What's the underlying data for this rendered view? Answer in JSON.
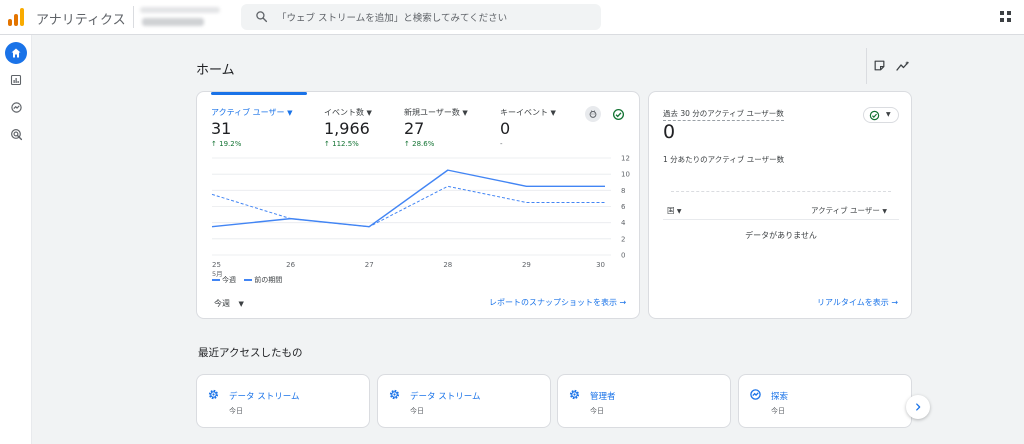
{
  "header": {
    "app_title": "アナリティクス",
    "search_placeholder": "「ウェブ ストリームを追加」と検索してみてください"
  },
  "colors": {
    "primary": "#1a73e8",
    "positive": "#137333",
    "series_line": "#4285f4",
    "logo_bars": [
      "#f9ab00",
      "#e37400",
      "#e37400"
    ]
  },
  "page": {
    "title": "ホーム"
  },
  "metrics": [
    {
      "label": "アクティブ ユーザー",
      "value": "31",
      "change": "19.2%",
      "trend": "up",
      "selected": true
    },
    {
      "label": "イベント数",
      "value": "1,966",
      "change": "112.5%",
      "trend": "up",
      "selected": false
    },
    {
      "label": "新規ユーザー数",
      "value": "27",
      "change": "28.6%",
      "trend": "up",
      "selected": false
    },
    {
      "label": "キーイベント",
      "value": "0",
      "change": "-",
      "trend": "none",
      "selected": false
    }
  ],
  "chart_data": {
    "type": "line",
    "categories": [
      "25",
      "26",
      "27",
      "28",
      "29",
      "30"
    ],
    "x_sublabel": "5月",
    "ylim": [
      0,
      12
    ],
    "yticks": [
      0,
      2,
      4,
      6,
      8,
      10,
      12
    ],
    "y_axis_side": "right",
    "grid": true,
    "series": [
      {
        "name": "今週",
        "style": "solid",
        "values": [
          3.5,
          4.5,
          3.5,
          10.5,
          8.5,
          8.5
        ]
      },
      {
        "name": "前の期間",
        "style": "dashed",
        "values": [
          7.5,
          4.5,
          3.5,
          8.5,
          6.5,
          6.5
        ]
      }
    ],
    "legend_position": "bottom-left"
  },
  "main_card": {
    "period_label": "今週",
    "snapshot_link": "レポートのスナップショットを表示"
  },
  "realtime": {
    "title": "過去 30 分のアクティブ ユーザー数",
    "value": "0",
    "subtitle": "1 分あたりのアクティブ ユーザー数",
    "col_country": "国",
    "col_users": "アクティブ ユーザー",
    "empty_text": "データがありません",
    "link": "リアルタイムを表示"
  },
  "recent": {
    "title": "最近アクセスしたもの",
    "items": [
      {
        "label": "データ ストリーム",
        "sub": "今日",
        "icon": "gear-icon"
      },
      {
        "label": "データ ストリーム",
        "sub": "今日",
        "icon": "gear-icon"
      },
      {
        "label": "管理者",
        "sub": "今日",
        "icon": "gear-icon"
      },
      {
        "label": "探索",
        "sub": "今日",
        "icon": "explore-icon"
      }
    ]
  }
}
